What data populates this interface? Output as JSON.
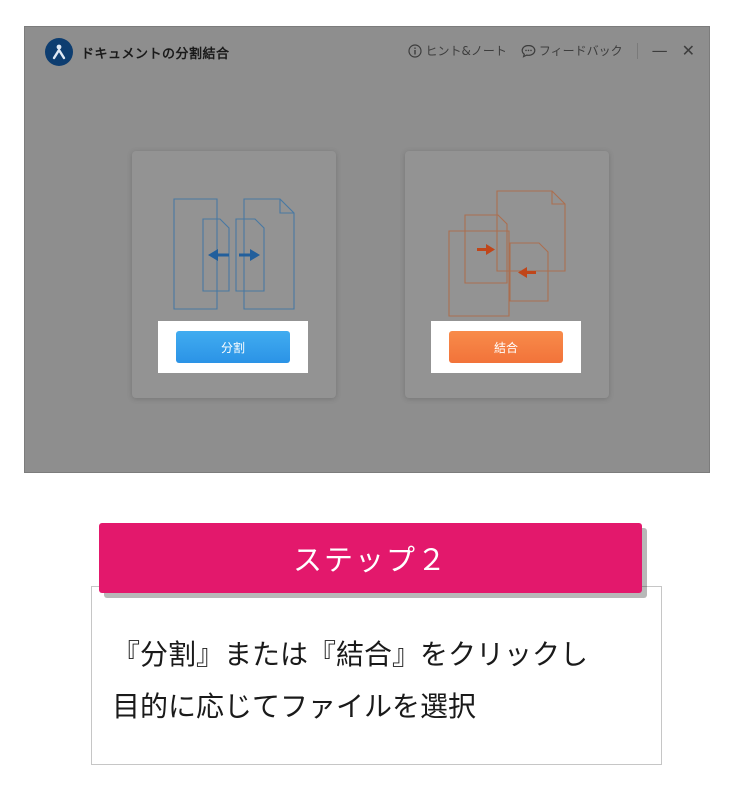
{
  "app": {
    "title": "ドキュメントの分割結合",
    "hint_label": "ヒント&ノート",
    "feedback_label": "フィードバック",
    "minimize_glyph": "—",
    "close_glyph": "✕"
  },
  "cards": {
    "split": {
      "button_label": "分割",
      "icon": "split-documents-icon"
    },
    "merge": {
      "button_label": "結合",
      "icon": "merge-documents-icon"
    }
  },
  "step": {
    "label": "ステップ２"
  },
  "instruction": {
    "line1": "『分割』または『結合』をクリックし",
    "line2": "目的に応じてファイルを選択"
  },
  "colors": {
    "overlay": "#8e8e8e",
    "split_accent": "#2b93e6",
    "merge_accent": "#f2733a",
    "banner": "#e3186c"
  }
}
